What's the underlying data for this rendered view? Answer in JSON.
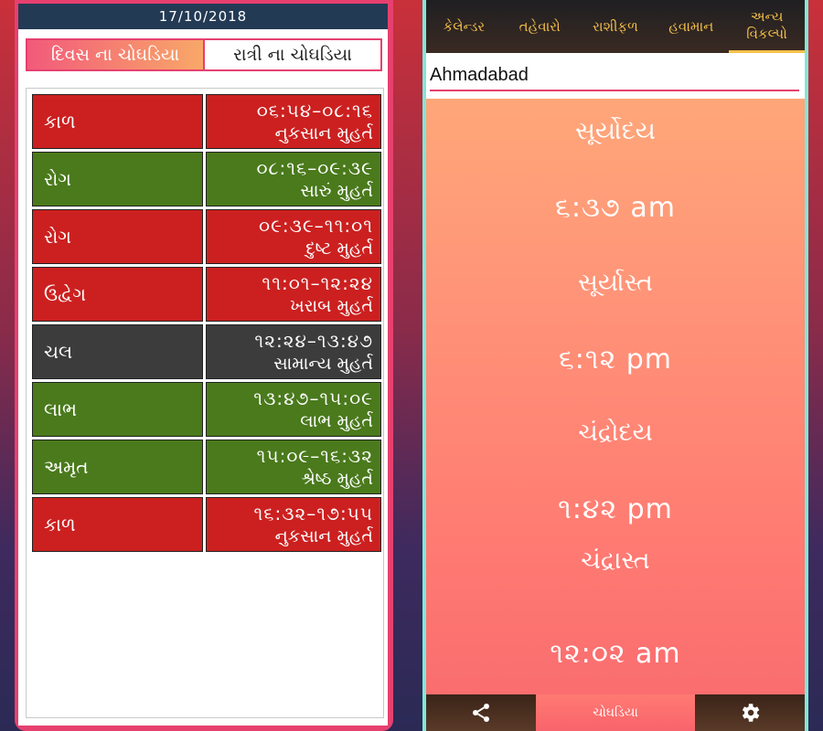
{
  "left": {
    "date": "17/10/2018",
    "tabs": [
      "દિવસ ના ચોઘડિયા",
      "રાત્રી ના ચોઘડિયા"
    ],
    "rows": [
      {
        "name": "કાળ",
        "time": "૦૬:૫૪–૦૮:૧૬",
        "quality": "નુકસાન મુહર્ત",
        "color": "#cc2020"
      },
      {
        "name": "રોગ",
        "time": "૦૮:૧૬–૦૯:૩૯",
        "quality": "સારું મુહર્ત",
        "color": "#4a7a1c"
      },
      {
        "name": "રોગ",
        "time": "૦૯:૩૯–૧૧:૦૧",
        "quality": "દુષ્ટ મુહર્ત",
        "color": "#cc2020"
      },
      {
        "name": "ઉદ્વેગ",
        "time": "૧૧:૦૧–૧૨:૨૪",
        "quality": "ખરાબ મુહર્ત",
        "color": "#cc2020"
      },
      {
        "name": "ચલ",
        "time": "૧૨:૨૪–૧૩:૪૭",
        "quality": "સામાન્ય મુહર્ત",
        "color": "#3c3c3c"
      },
      {
        "name": "લાભ",
        "time": "૧૩:૪૭–૧૫:૦૯",
        "quality": "લાભ મુહર્ત",
        "color": "#4a7a1c"
      },
      {
        "name": "અમૃત",
        "time": "૧૫:૦૯–૧૬:૩૨",
        "quality": "શ્રેષ્ઠ મુહર્ત",
        "color": "#4a7a1c"
      },
      {
        "name": "કાળ",
        "time": "૧૬:૩૨–૧૭:૫૫",
        "quality": "નુકસાન મુહર્ત",
        "color": "#cc2020"
      }
    ]
  },
  "right": {
    "nav": [
      "કેલેન્ડર",
      "તહેવારો",
      "રાશીફળ",
      "હવામાન",
      "અન્ય\nવિકલ્પો"
    ],
    "city": "Ahmadabad",
    "sun_items": [
      {
        "label": "સૂર્યોદય",
        "value": "૬:૩૭ am"
      },
      {
        "label": "સૂર્યાસ્ત",
        "value": "૬:૧૨ pm"
      },
      {
        "label": "ચંદ્રોદય",
        "value": "૧:૪૨ pm"
      },
      {
        "label": "ચંદ્રાસ્ત",
        "value": "૧૨:૦૨ am"
      }
    ],
    "bottom_label": "ચોઘડિયા",
    "icons": {
      "share": "share-icon",
      "settings": "gear-icon"
    }
  }
}
